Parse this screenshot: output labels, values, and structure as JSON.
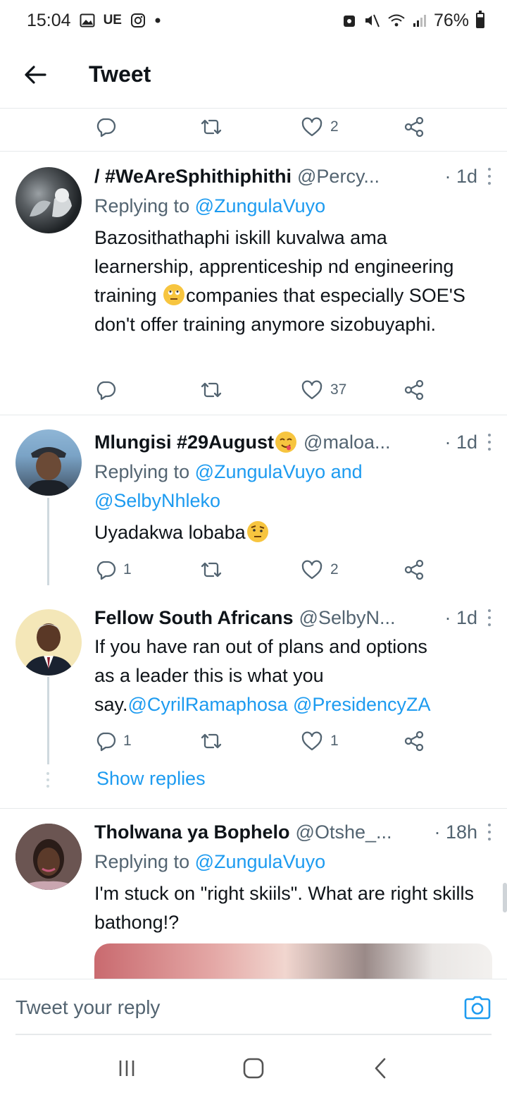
{
  "status_bar": {
    "time": "15:04",
    "carrier_badge": "UE",
    "battery": "76%"
  },
  "header": {
    "title": "Tweet"
  },
  "top_actions": {
    "likes": "2"
  },
  "tweets": [
    {
      "name": "/ #WeAreSphithiphithi",
      "handle": "@Percy...",
      "time": "· 1d",
      "replying_prefix": "Replying to ",
      "replying_to": "@ZungulaVuyo",
      "text_part1": "Bazosithathaphi iskill kuvalwa ama learnership, apprenticeship nd engineering training ",
      "text_part2": "companies that especially SOE'S don't offer training anymore sizobuyaphi.",
      "replies": "",
      "retweets": "",
      "likes": "37"
    },
    {
      "name": "Mlungisi #29August",
      "handle": "@maloa...",
      "time": "· 1d",
      "replying_prefix": "Replying to ",
      "replying_to": "@ZungulaVuyo and",
      "replying_to_2": "@SelbyNhleko",
      "text": "Uyadakwa lobaba",
      "replies": "1",
      "retweets": "",
      "likes": "2"
    },
    {
      "name": "Fellow South Africans",
      "handle": "@SelbyN...",
      "time": "· 1d",
      "text_line1": "If you have ran out of plans and options",
      "text_line2": "as a leader this is what you",
      "text_line3_prefix": "say.",
      "mention1": "@CyrilRamaphosa",
      "mention2": "@PresidencyZA",
      "replies": "1",
      "retweets": "",
      "likes": "1",
      "show_replies": "Show replies"
    },
    {
      "name": "Tholwana ya Bophelo",
      "handle": "@Otshe_...",
      "time": "· 18h",
      "replying_prefix": "Replying to ",
      "replying_to": "@ZungulaVuyo",
      "text": "I'm stuck on \"right skiils\". What are right skills bathong!?"
    }
  ],
  "reply_bar": {
    "placeholder": "Tweet your reply"
  },
  "colors": {
    "accent": "#1d9bf0",
    "text": "#0f1419",
    "muted": "#536471",
    "divider": "#e6e9eb"
  },
  "icons": [
    "back-arrow-icon",
    "reply-icon",
    "retweet-icon",
    "like-icon",
    "share-icon",
    "more-icon",
    "camera-icon",
    "recent-apps-icon",
    "home-icon",
    "back-nav-icon"
  ]
}
